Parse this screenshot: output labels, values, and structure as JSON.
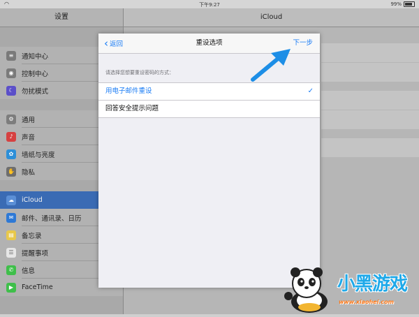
{
  "status_bar": {
    "time": "下午9:27",
    "battery": "99%"
  },
  "sidebar": {
    "title": "设置",
    "groups": [
      [
        {
          "label": "通知中心",
          "icon": "notification-center-icon",
          "color": "#7a7a7a"
        },
        {
          "label": "控制中心",
          "icon": "control-center-icon",
          "color": "#7a7a7a"
        },
        {
          "label": "勿扰模式",
          "icon": "moon-icon",
          "color": "#5b4fc9"
        }
      ],
      [
        {
          "label": "通用",
          "icon": "gear-icon",
          "color": "#7d7d7d"
        },
        {
          "label": "声音",
          "icon": "speaker-icon",
          "color": "#d64141"
        },
        {
          "label": "墙纸与亮度",
          "icon": "wallpaper-icon",
          "color": "#2d8fd8"
        },
        {
          "label": "隐私",
          "icon": "hand-icon",
          "color": "#6e6e6e"
        }
      ],
      [
        {
          "label": "iCloud",
          "icon": "cloud-icon",
          "color": "#5b8fd6",
          "selected": true
        },
        {
          "label": "邮件、通讯录、日历",
          "icon": "mail-icon",
          "color": "#2e79d6"
        },
        {
          "label": "备忘录",
          "icon": "notes-icon",
          "color": "#e8c84a"
        },
        {
          "label": "提醒事项",
          "icon": "reminders-icon",
          "color": "#e6e6e6"
        },
        {
          "label": "信息",
          "icon": "messages-icon",
          "color": "#3fbf4a"
        },
        {
          "label": "FaceTime",
          "icon": "facetime-icon",
          "color": "#3fbf4a"
        }
      ]
    ]
  },
  "detail": {
    "title": "iCloud"
  },
  "modal": {
    "back_label": "返回",
    "title": "重设选项",
    "next_label": "下一步",
    "hint": "请选择您想要重设密码的方式：",
    "options": [
      {
        "label": "用电子邮件重设",
        "selected": true
      },
      {
        "label": "回答安全提示问题",
        "selected": false
      }
    ]
  },
  "colors": {
    "accent": "#1a7cf5",
    "selected_row": "#3a6bb4",
    "arrow": "#1d8ee6"
  },
  "watermark": {
    "logo_text": "小黑游戏",
    "url": "www.xiaohei.com"
  }
}
